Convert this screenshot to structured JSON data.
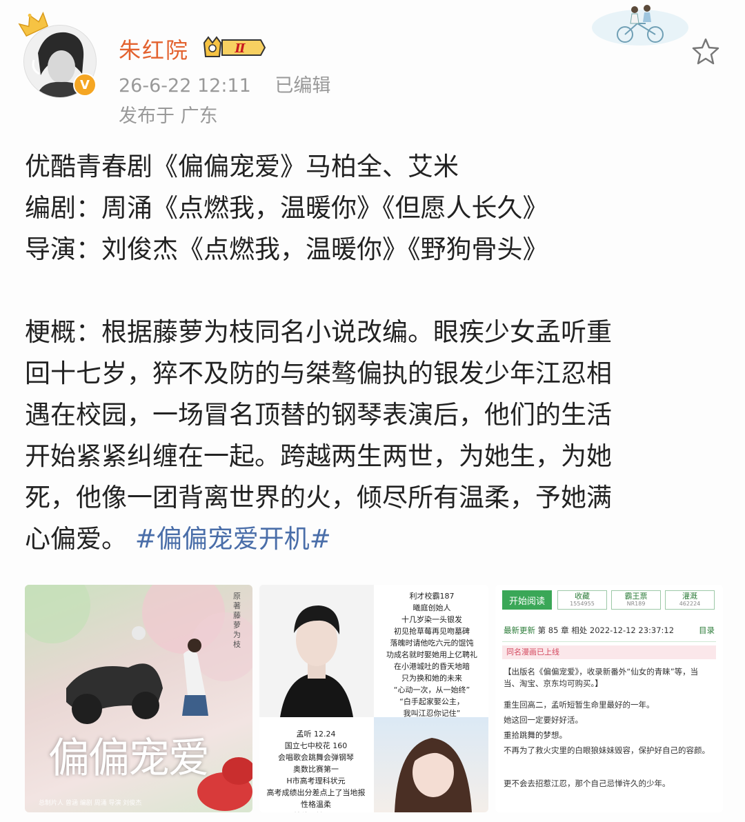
{
  "post": {
    "username": "朱红院",
    "level": "Ⅱ",
    "verified_mark": "V",
    "timestamp": "26-6-22 12:11",
    "edited": "已编辑",
    "location": "发布于 广东",
    "lines": [
      "优酷青春剧《偏偏宠爱》马柏全、艾米",
      "编剧：周涌《点燃我，温暖你》《但愿人长久》",
      "导演：刘俊杰《点燃我，温暖你》《野狗骨头》"
    ],
    "synopsis_lines": [
      "梗概：根据藤萝为枝同名小说改编。眼疾少女孟听重",
      "回十七岁，猝不及防的与桀骜偏执的银发少年江忍相",
      "遇在校园，一场冒名顶替的钢琴表演后，他们的生活",
      "开始紧紧纠缠在一起。跨越两生两世，为她生，为她",
      "死，他像一团背离世界的火，倾尽所有温柔，予她满"
    ],
    "last_line_prefix": "心偏爱。",
    "topic": "#偏偏宠爱开机#"
  },
  "images": {
    "poster": {
      "title": "偏偏宠爱",
      "side_text": "原著 藤萝为枝",
      "credits": "总制片人 曾涵 编剧 周涌 导演 刘俊杰"
    },
    "character_card": {
      "boy_info": "利才校霸187\n曦庭创始人\n十几岁染一头银发\n初见抢草莓再见吻墓碑\n落魄时请他吃六元的馄饨\n功成名就时娶她用上亿聘礼\n在小港城吐的昏天地暗\n只为换和她的未来\n“心动一次，从一始终”\n“白手起家娶公主，\n我叫江忍你记住”",
      "girl_info": "孟听 12.24\n国立七中校花 160\n会唱歌会跳舞会弹钢琴\n奥数比赛第一\nH市高考理科状元\n高考成绩出分差点上了当地报\n性格温柔\n美貌是她不…"
    },
    "reader": {
      "btn_read": "开始阅读",
      "btn_collect": "收藏",
      "collect_count": "1554955",
      "btn_ticket": "霸王票",
      "ticket_count": "NR189",
      "btn_water": "灌溉",
      "water_count": "462224",
      "update_label": "最新更新",
      "update_text": "第 85 章 相处 2022-12-12 23:37:12",
      "directory": "目录",
      "manhua": "同名漫画已上线",
      "para1": "【出版名《偏偏宠爱》，收录新番外“仙女的青睐”等，当当、淘宝、京东均可购买。】",
      "para2": "重生回高二，孟听短暂生命里最好的一年。",
      "para3": "她这回一定要好好活。",
      "para4": "重拾跳舞的梦想。",
      "para5": "不再为了救火灾里的白眼狼妹妹毁容，保护好自己的容颜。",
      "para6": "更不会去招惹江忍，那个自己忌惮许久的少年。"
    }
  },
  "colors": {
    "username": "#e3622f",
    "topic": "#4a6ea9",
    "meta": "#999999",
    "reader_green": "#3aa757"
  },
  "icons": [
    "crown-icon",
    "verified-badge-icon",
    "level-badge-icon",
    "star-icon",
    "couple-bicycle-decoration"
  ]
}
